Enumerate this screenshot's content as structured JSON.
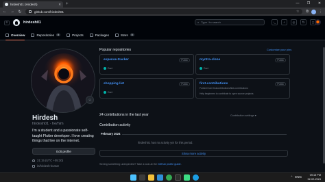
{
  "browser": {
    "tab_title": "hirdesh01 (Hirdesh)",
    "url": "github.com/hirdesh01",
    "window_controls": [
      "—",
      "❐",
      "✕"
    ]
  },
  "header": {
    "username": "hirdesh01",
    "search_placeholder": "Type / to search",
    "nav": [
      {
        "label": "Overview",
        "count": null
      },
      {
        "label": "Repositories",
        "count": "5"
      },
      {
        "label": "Projects",
        "count": null
      },
      {
        "label": "Packages",
        "count": null
      },
      {
        "label": "Stars",
        "count": "5"
      }
    ]
  },
  "profile": {
    "full_name": "Hirdesh",
    "login": "hirdesh01 · he/him",
    "bio": "I'm a student and a passionate self-taught Flutter developer. I love creating things that live on the internet.",
    "edit_button": "Edit profile",
    "local_time": "21:15 (UTC +05:30)",
    "social": "in/hirdesh-kumar"
  },
  "popular": {
    "title": "Popular repositories",
    "customize_link": "Customize your pins",
    "repos": [
      {
        "name": "expense-tracker",
        "visibility": "Public",
        "description": "",
        "language": "Dart",
        "lang_color": "#00b4ab"
      },
      {
        "name": "myntra-clone",
        "visibility": "Public",
        "description": "",
        "language": "Dart",
        "lang_color": "#00b4ab"
      },
      {
        "name": "shopping-list",
        "visibility": "Public",
        "description": "",
        "language": "Dart",
        "lang_color": "#00b4ab"
      },
      {
        "name": "first-contributions",
        "visibility": "Public",
        "description": "Forked from firstcontributions/first-contributions",
        "extra": "Help beginners to contribute to open source projects",
        "language": "",
        "lang_color": ""
      }
    ]
  },
  "contributions": {
    "count_text": "24 contributions in the last year",
    "settings_label": "Contribution settings",
    "activity_title": "Contribution activity",
    "month": "February 2024",
    "no_activity": "hirdesh01 has no activity yet for this period.",
    "more_button": "Show more activity",
    "feedback_prefix": "Seeing something unexpected? Take a look at the",
    "feedback_link": "GitHub profile guide"
  },
  "taskbar": {
    "time": "09:15 PM",
    "date": "02-02-2024",
    "tray": [
      "ENG",
      "⌃"
    ],
    "apps": [
      {
        "name": "windows-start",
        "color": "#4cc2ff"
      },
      {
        "name": "search",
        "color": "#3a3a3a"
      },
      {
        "name": "file-explorer",
        "color": "#f3c13a"
      },
      {
        "name": "vscode",
        "color": "#2f8fd8"
      },
      {
        "name": "chrome",
        "color": "#34a853"
      },
      {
        "name": "terminal",
        "color": "#2d2d2d"
      },
      {
        "name": "android-studio",
        "color": "#3ddc84"
      },
      {
        "name": "edge",
        "color": "#1b9de2"
      }
    ]
  }
}
